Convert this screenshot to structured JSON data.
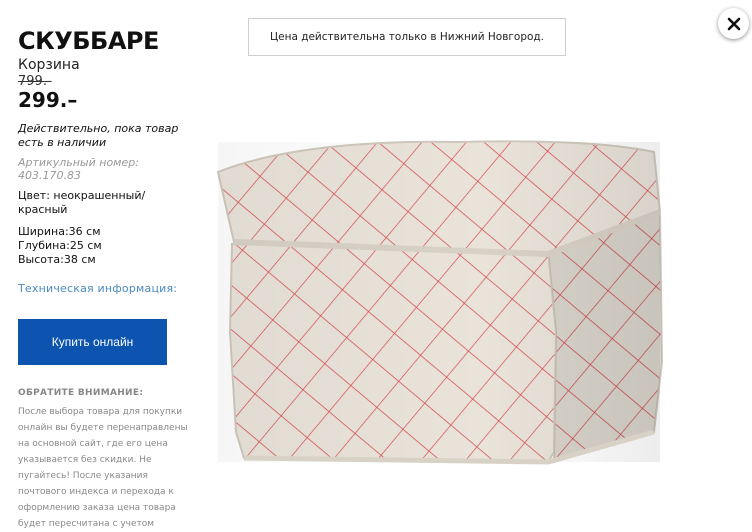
{
  "product": {
    "title": "СКУББАРЕ",
    "subtitle": "Корзина",
    "old_price": "799.-",
    "price": "299.–",
    "availability": "Действительно, пока товар есть в наличии",
    "article": "Артикульный номер: 403.170.83",
    "color": "Цвет: неокрашенный/ красный",
    "dimensions": [
      "Ширина:36 см",
      "Глубина:25 см",
      "Высота:38 см"
    ],
    "tech_info_link": "Техническая информация:",
    "buy_button": "Купить онлайн"
  },
  "notice": {
    "heading": "ОБРАТИТЕ ВНИМАНИЕ:",
    "text": "После выбора товара для покупки онлайн вы будете перенаправлены на основной сайт, где его цена указывается без скидки. Не пугайтесь! После указания почтового индекса и перехода к оформлению заказа цена товара будет пересчитана с учетом"
  },
  "banner": {
    "text": "Цена действительна только в Нижний Новгород."
  },
  "icons": {
    "close": "close-icon",
    "product_image": "basket-image"
  },
  "colors": {
    "button": "#0d53b0",
    "link": "#4a8ac0",
    "pattern": "#d9474a",
    "fabric": "#e8e2d8"
  }
}
